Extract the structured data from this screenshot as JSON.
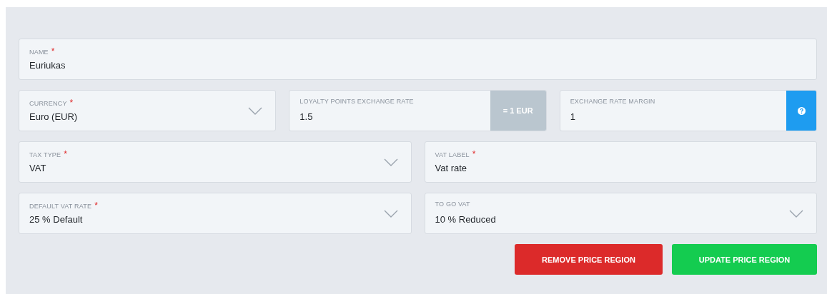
{
  "form_rows": [
    {
      "fields": [
        {
          "label": "NAME",
          "required_mark": "*",
          "value": "Euriukas",
          "kind": "text"
        }
      ]
    },
    {
      "fields": [
        {
          "label": "CURRENCY",
          "required_mark": "*",
          "value": "Euro (EUR)",
          "kind": "select"
        },
        {
          "label": "LOYALTY POINTS EXCHANGE RATE",
          "value": "1.5",
          "kind": "addon",
          "addon": "= 1 EUR"
        },
        {
          "label": "EXCHANGE RATE MARGIN",
          "value": "1",
          "kind": "help"
        }
      ]
    },
    {
      "fields": [
        {
          "label": "TAX TYPE",
          "required_mark": "*",
          "value": "VAT",
          "kind": "select"
        },
        {
          "label": "VAT LABEL",
          "required_mark": "*",
          "value": "Vat rate",
          "kind": "text"
        }
      ]
    },
    {
      "fields": [
        {
          "label": "DEFAULT VAT RATE",
          "required_mark": "*",
          "value": "25 % Default",
          "kind": "select"
        },
        {
          "label": "TO GO VAT",
          "value": "10 % Reduced",
          "kind": "select"
        }
      ]
    }
  ],
  "buttons": [
    {
      "label": "REMOVE PRICE REGION",
      "kind": "danger"
    },
    {
      "label": "UPDATE PRICE REGION",
      "kind": "primary"
    }
  ]
}
